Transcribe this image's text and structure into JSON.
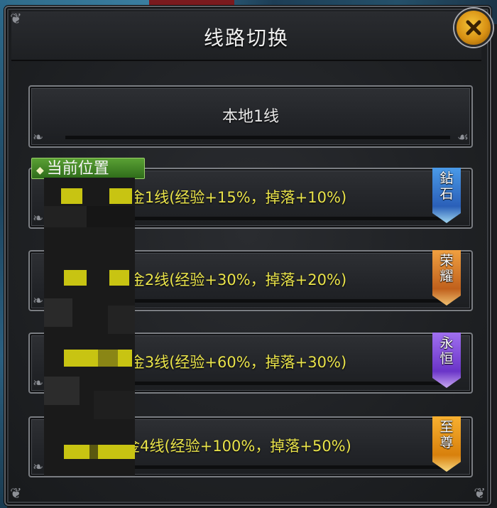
{
  "window": {
    "title": "线路切换",
    "close_icon": "close-icon"
  },
  "local_line": {
    "label": "本地1线"
  },
  "current_tag": {
    "label": "当前位置"
  },
  "lines": [
    {
      "label": "黄金1线(经验+15%，掉落+10%)",
      "badge": [
        "鉆",
        "石"
      ],
      "badge_color": "#3b88d8"
    },
    {
      "label": "黄金2线(经验+30%，掉落+20%)",
      "badge": [
        "荣",
        "耀"
      ],
      "badge_color": "#d8762a"
    },
    {
      "label": "黄金3线(经验+60%，掉落+30%)",
      "badge": [
        "永",
        "恒"
      ],
      "badge_color": "#8a4fd8"
    },
    {
      "label": "黄金4线(经验+100%，掉落+50%)",
      "badge": [
        "至",
        "尊"
      ],
      "badge_color": "#e89420"
    }
  ],
  "colors": {
    "line_text": "#e9e34a",
    "title_text": "#f0f0f0",
    "current_tag_bg": "#3f8a26"
  }
}
